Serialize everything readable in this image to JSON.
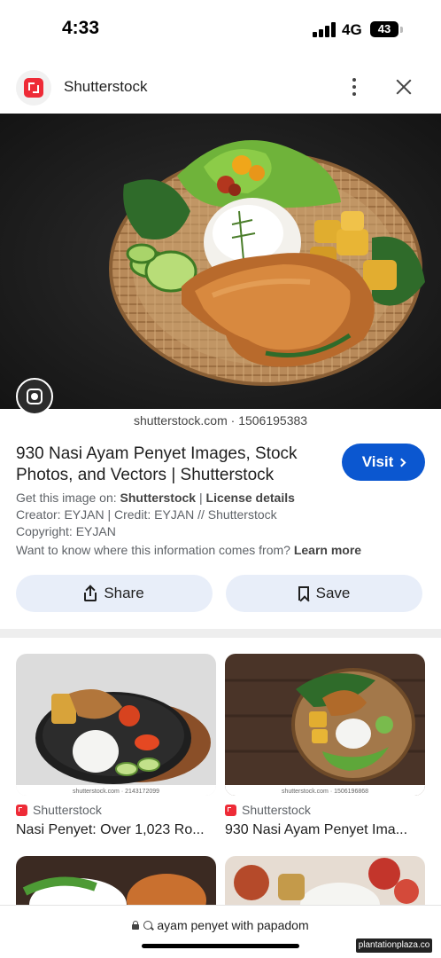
{
  "status_bar": {
    "time": "4:33",
    "network": "4G",
    "battery": "43"
  },
  "source": {
    "name": "Shutterstock"
  },
  "image": {
    "watermark": "shutterstock.com · 1506195383"
  },
  "result": {
    "title": "930 Nasi Ayam Penyet Images, Stock Photos, and Vectors | Shutterstock",
    "visit_label": "Visit",
    "get_image_prefix": "Get this image on:",
    "get_image_source": "Shutterstock",
    "separator": "|",
    "license_label": "License details",
    "creator_line": "Creator: EYJAN | Credit: EYJAN // Shutterstock",
    "copyright_line": "Copyright: EYJAN",
    "info_question": "Want to know where this information comes from?",
    "learn_more": "Learn more"
  },
  "actions": {
    "share_label": "Share",
    "save_label": "Save"
  },
  "related": [
    {
      "source": "Shutterstock",
      "title": "Nasi Penyet: Over 1,023 Ro...",
      "caption": "shutterstock.com · 2143172099"
    },
    {
      "source": "Shutterstock",
      "title": "930 Nasi Ayam Penyet Ima...",
      "caption": "shutterstock.com · 1506196868"
    }
  ],
  "address_bar": {
    "query": "ayam penyet with papadom"
  },
  "site_watermark": "plantationplaza.co",
  "colors": {
    "accent": "#0b57d0",
    "brand": "#ee2b37",
    "action_bg": "#e8eef9"
  },
  "icons": [
    "shutterstock-logo-icon",
    "more-vert-icon",
    "close-icon",
    "lens-icon",
    "share-icon",
    "bookmark-icon",
    "chevron-right-icon",
    "lock-icon",
    "search-icon"
  ]
}
